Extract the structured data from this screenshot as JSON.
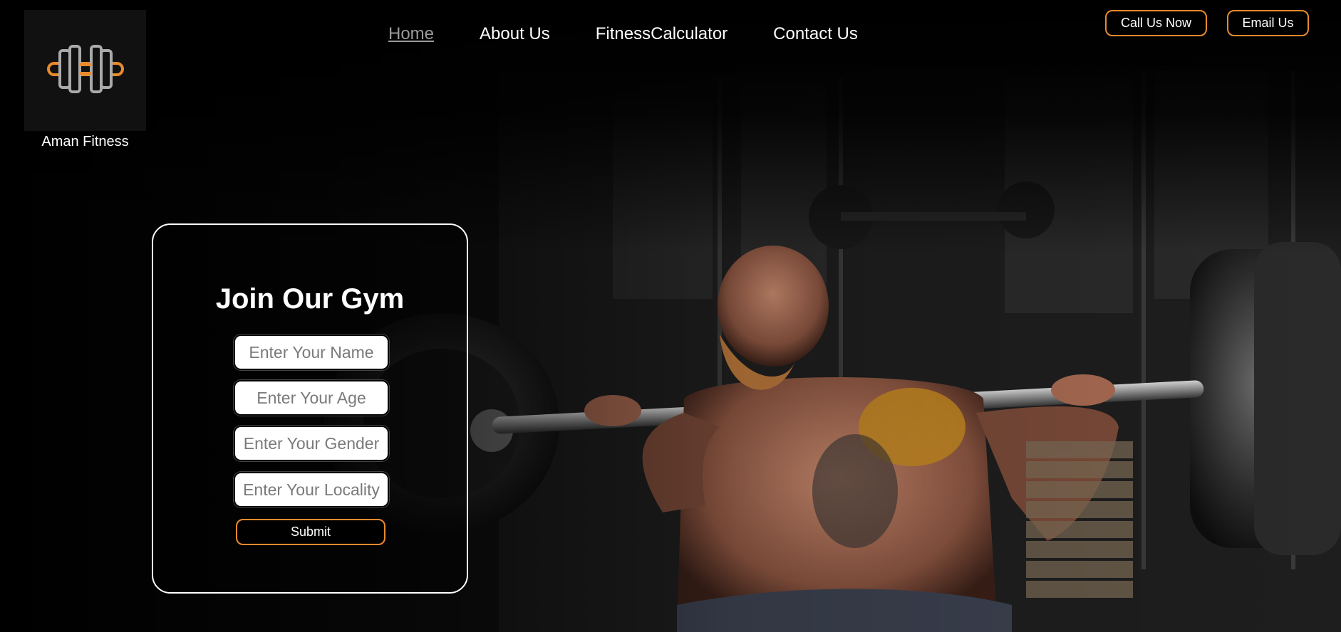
{
  "brand": {
    "name": "Aman Fitness",
    "logo_icon": "dumbbell-icon",
    "accent_color": "#e88a2e"
  },
  "nav": {
    "items": [
      {
        "label": "Home",
        "active": true
      },
      {
        "label": "About Us",
        "active": false
      },
      {
        "label": "FitnessCalculator",
        "active": false
      },
      {
        "label": "Contact Us",
        "active": false
      }
    ]
  },
  "header_buttons": {
    "call_label": "Call Us Now",
    "email_label": "Email Us"
  },
  "form": {
    "title": "Join Our Gym",
    "name_placeholder": "Enter Your Name",
    "age_placeholder": "Enter Your Age",
    "gender_placeholder": "Enter Your Gender",
    "locality_placeholder": "Enter Your Locality",
    "submit_label": "Submit"
  }
}
